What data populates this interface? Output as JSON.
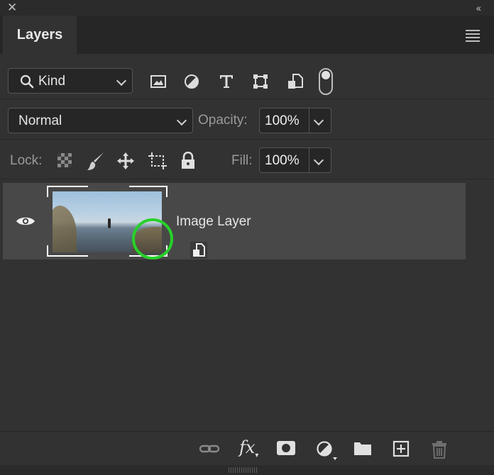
{
  "window": {
    "close_glyph": "✕",
    "collapse_glyph": "‹‹"
  },
  "tabs": [
    {
      "label": "Layers",
      "active": true
    }
  ],
  "filter": {
    "kind_label": "Kind",
    "icons": [
      "image-filter-icon",
      "adjustment-filter-icon",
      "type-filter-icon",
      "shape-filter-icon",
      "smart-object-filter-icon"
    ],
    "toggle_on": true
  },
  "blend": {
    "mode": "Normal",
    "opacity_label": "Opacity:",
    "opacity_value": "100%"
  },
  "lock": {
    "label": "Lock:",
    "icons": [
      "lock-transparent-pixels-icon",
      "lock-image-pixels-icon",
      "lock-position-icon",
      "lock-artboard-icon",
      "lock-all-icon"
    ],
    "fill_label": "Fill:",
    "fill_value": "100%"
  },
  "layers": [
    {
      "name": "Image Layer",
      "visible": true,
      "selected": true,
      "smart_object": true
    }
  ],
  "bottom_toolbar": {
    "icons": [
      "link-layers-icon",
      "fx-icon",
      "add-mask-icon",
      "new-adjustment-layer-icon",
      "new-group-icon",
      "new-layer-icon",
      "delete-layer-icon"
    ],
    "fx_label": "fx"
  },
  "colors": {
    "panel_bg": "#323232",
    "selected_row": "#484848",
    "highlight_ring": "#27d12a"
  }
}
